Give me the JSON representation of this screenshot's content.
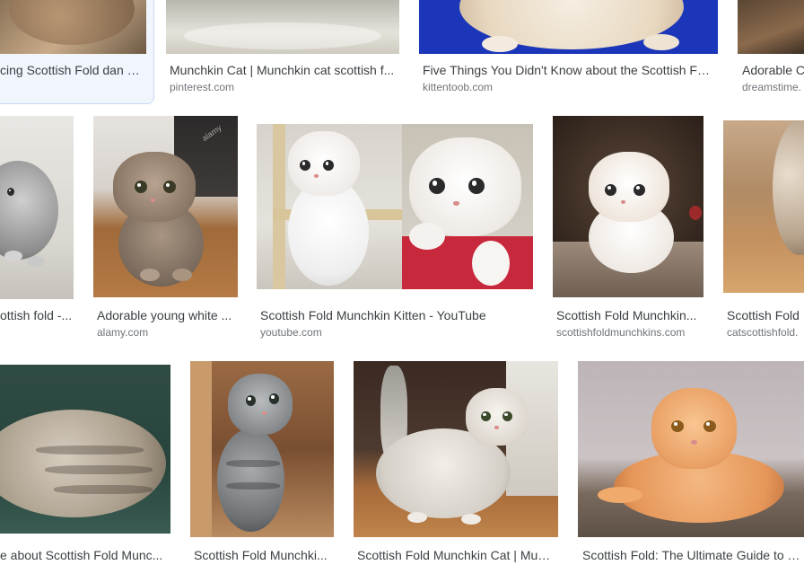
{
  "results": [
    {
      "caption": "cing Scottish Fold dan C...",
      "source": ""
    },
    {
      "caption": "Munchkin Cat | Munchkin cat scottish f...",
      "source": "pinterest.com"
    },
    {
      "caption": "Five Things You Didn't Know about the Scottish Fol...",
      "source": "kittentoob.com"
    },
    {
      "caption": "Adorable Cl",
      "source": "dreamstime."
    },
    {
      "caption": "ottish fold -...",
      "source": ""
    },
    {
      "caption": "Adorable young white ...",
      "source": "alamy.com"
    },
    {
      "caption": "Scottish Fold Munchkin Kitten - YouTube",
      "source": "youtube.com"
    },
    {
      "caption": "Scottish Fold Munchkin...",
      "source": "scottishfoldmunchkins.com"
    },
    {
      "caption": "Scottish Fold I",
      "source": "catscottishfold."
    },
    {
      "caption": "e about Scottish Fold Munc...",
      "source": ""
    },
    {
      "caption": "Scottish Fold Munchki...",
      "source": ""
    },
    {
      "caption": "Scottish Fold Munchkin Cat | Mun...",
      "source": ""
    },
    {
      "caption": "Scottish Fold: The Ultimate Guide to t...",
      "source": ""
    }
  ],
  "watermarks": {
    "alamy": "alamy"
  }
}
